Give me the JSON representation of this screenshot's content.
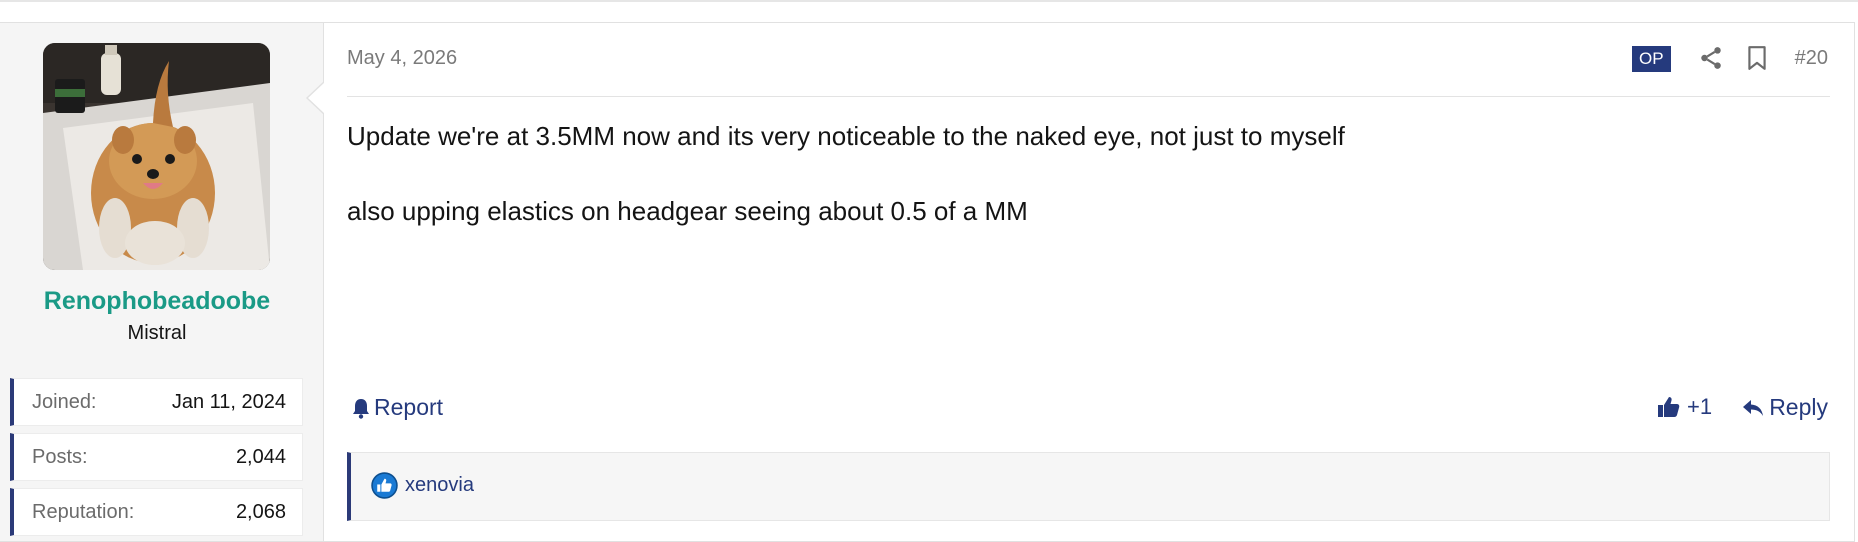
{
  "post": {
    "date": "May 4, 2026",
    "op_badge": "OP",
    "post_number": "#20",
    "body": [
      "Update we're at 3.5MM now and its very noticeable to the naked eye, not just to myself",
      "also upping elastics on headgear seeing about 0.5 of a MM"
    ],
    "actions": {
      "report_label": "Report",
      "like_label": "+1",
      "reply_label": "Reply"
    },
    "reactions": {
      "users": [
        "xenovia"
      ]
    }
  },
  "user": {
    "username": "Renophobeadoobe",
    "title": "Mistral",
    "stats": [
      {
        "label": "Joined:",
        "value": "Jan 11, 2024"
      },
      {
        "label": "Posts:",
        "value": "2,044"
      },
      {
        "label": "Reputation:",
        "value": "2,068"
      }
    ]
  },
  "colors": {
    "username": "#1a9a86",
    "accent": "#253a7d",
    "stat_border": "#2b3a78"
  },
  "icons": [
    "share-icon",
    "bookmark-icon",
    "bell-icon",
    "thumbs-up-icon",
    "reply-icon",
    "like-reaction-icon"
  ]
}
